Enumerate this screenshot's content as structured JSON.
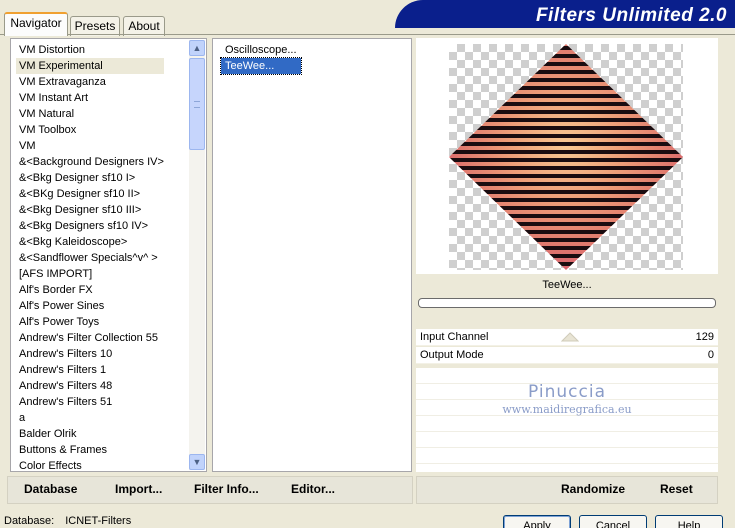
{
  "window": {
    "title": "Filters Unlimited 2.0"
  },
  "tabs": [
    {
      "label": "Navigator",
      "active": true
    },
    {
      "label": "Presets",
      "active": false
    },
    {
      "label": "About",
      "active": false
    }
  ],
  "categories": [
    "VM Distortion",
    "VM Experimental",
    "VM Extravaganza",
    "VM Instant Art",
    "VM Natural",
    "VM Toolbox",
    "VM",
    "&<Background Designers IV>",
    "&<Bkg Designer sf10 I>",
    "&<BKg Designer sf10 II>",
    "&<Bkg Designer sf10 III>",
    "&<Bkg Designers sf10 IV>",
    "&<Bkg Kaleidoscope>",
    "&<Sandflower Specials^v^ >",
    "[AFS IMPORT]",
    "Alf's Border FX",
    "Alf's Power Sines",
    "Alf's Power Toys",
    "Andrew's Filter Collection 55",
    "Andrew's Filters 10",
    "Andrew's Filters 1",
    "Andrew's Filters 48",
    "Andrew's Filters 51",
    "a",
    "Balder Olrik",
    "Buttons & Frames",
    "Color Effects"
  ],
  "selected_category": "VM Experimental",
  "filters": [
    "Oscilloscope...",
    "TeeWee..."
  ],
  "selected_filter": "TeeWee...",
  "preview": {
    "caption": "TeeWee..."
  },
  "parameters": [
    {
      "label": "Input Channel",
      "value": "129"
    },
    {
      "label": "Output Mode",
      "value": "0"
    }
  ],
  "watermark": {
    "name": "Pinuccia",
    "url": "www.maidiregrafica.eu"
  },
  "left_buttons": [
    {
      "label": "Database",
      "mnemonic": "D"
    },
    {
      "label": "Import...",
      "mnemonic": "I"
    },
    {
      "label": "Filter Info...",
      "mnemonic": "I"
    },
    {
      "label": "Editor...",
      "mnemonic": "E"
    }
  ],
  "right_buttons": [
    {
      "label": "Randomize"
    },
    {
      "label": "Reset"
    }
  ],
  "status": {
    "label": "Database:",
    "value": "ICNET-Filters"
  },
  "dialog_buttons": [
    {
      "label": "Apply"
    },
    {
      "label": "Cancel"
    },
    {
      "label": "Help"
    }
  ],
  "colors": {
    "banner": "#0a1f8c",
    "selection": "#316ac5",
    "active_tab_accent": "#f0a030"
  }
}
